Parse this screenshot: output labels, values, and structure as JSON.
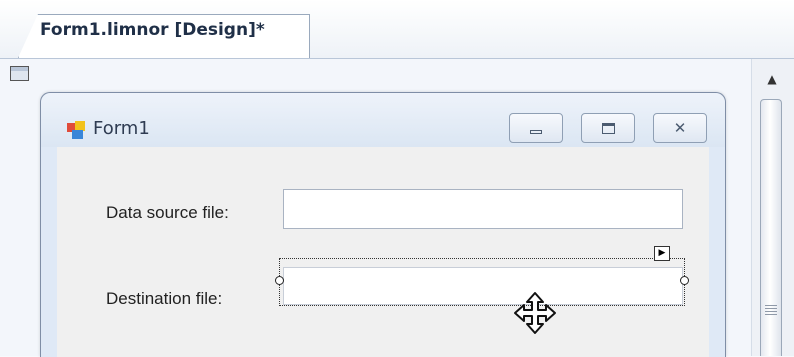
{
  "tab": {
    "title": "Form1.limnor [Design]*"
  },
  "form": {
    "title": "Form1",
    "labels": {
      "source": "Data source file:",
      "destination": "Destination file:"
    },
    "fields": {
      "source_value": "",
      "destination_value": ""
    }
  },
  "icons": {
    "form": "form-app-icon",
    "minimize": "minimize-icon",
    "maximize": "maximize-icon",
    "close": "close-icon",
    "move_cursor": "move-cursor-icon",
    "smart_tag": "smart-tag-arrow-icon",
    "scroll_up": "scroll-up-arrow-icon"
  }
}
